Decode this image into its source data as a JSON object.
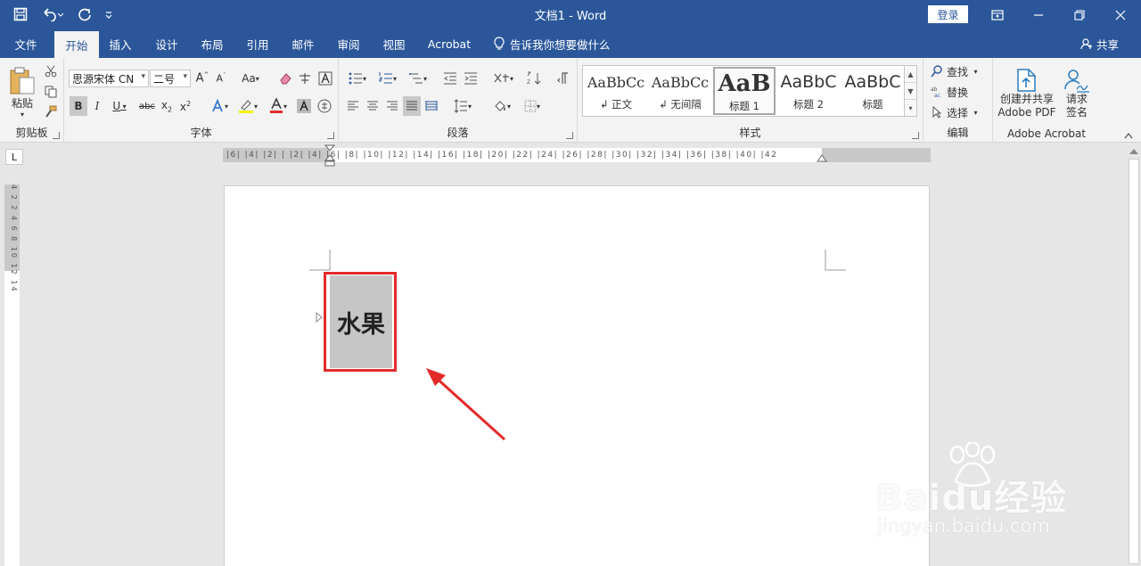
{
  "window": {
    "title": "文档1  -  Word",
    "login_label": "登录"
  },
  "tabs": [
    {
      "label": "文件"
    },
    {
      "label": "开始"
    },
    {
      "label": "插入"
    },
    {
      "label": "设计"
    },
    {
      "label": "布局"
    },
    {
      "label": "引用"
    },
    {
      "label": "邮件"
    },
    {
      "label": "审阅"
    },
    {
      "label": "视图"
    },
    {
      "label": "Acrobat"
    }
  ],
  "tellme": "告诉我你想要做什么",
  "share": "共享",
  "ribbon": {
    "clipboard": {
      "label": "剪贴板",
      "paste": "粘贴"
    },
    "font": {
      "label": "字体",
      "font_name": "思源宋体 CN",
      "font_size": "二号",
      "change_case": "Aa"
    },
    "paragraph": {
      "label": "段落"
    },
    "styles": {
      "label": "样式",
      "items": [
        {
          "preview": "AaBbCc",
          "name": "↲ 正文"
        },
        {
          "preview": "AaBbCc",
          "name": "↲ 无间隔"
        },
        {
          "preview": "AaB",
          "name": "标题 1"
        },
        {
          "preview": "AaBbC",
          "name": "标题 2"
        },
        {
          "preview": "AaBbC",
          "name": "标题"
        }
      ]
    },
    "editing": {
      "label": "编辑",
      "find": "查找",
      "replace": "替换",
      "select": "选择"
    },
    "acrobat": {
      "label": "Adobe Acrobat",
      "create_line1": "创建并共享",
      "create_line2": "Adobe PDF",
      "sign_line1": "请求",
      "sign_line2": "签名"
    }
  },
  "ruler": {
    "horizontal_labels": "|6| |4| |2| | |2| |4| |6| |8| |10| |12| |14| |16| |18| |20| |22| |24| |26| |28| |30| |32| |34| |36| |38| |40| |42",
    "vertical_labels": "4 2 2 4 6 8 10 12 14",
    "tab_selector": "L"
  },
  "document": {
    "selected_text": "水果"
  },
  "watermark": {
    "brand": "Baidu经验",
    "url": "jingyan.baidu.com"
  },
  "colors": {
    "accent": "#2b579a",
    "highlight": "#e32b2b",
    "selection": "#c6c6c6"
  }
}
